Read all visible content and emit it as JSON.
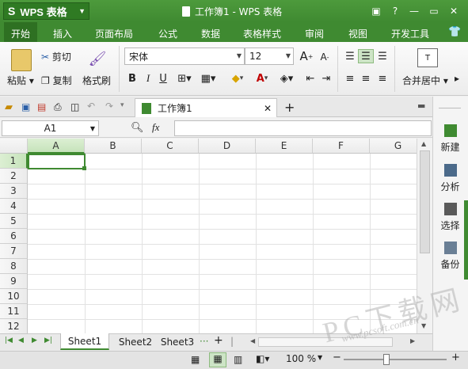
{
  "app": {
    "name": "WPS 表格",
    "logo": "S",
    "title": "工作簿1 - WPS 表格"
  },
  "menu_tabs": [
    "开始",
    "插入",
    "页面布局",
    "公式",
    "数据",
    "表格样式",
    "审阅",
    "视图",
    "开发工具"
  ],
  "ribbon": {
    "paste": "粘贴",
    "cut": "剪切",
    "copy": "复制",
    "format_painter": "格式刷",
    "font_name": "宋体",
    "font_size": "12",
    "merge_center": "合并居中"
  },
  "doc_tab": {
    "name": "工作簿1"
  },
  "formula_bar": {
    "name_box": "A1",
    "fx": "fx",
    "value": ""
  },
  "columns": [
    "A",
    "B",
    "C",
    "D",
    "E",
    "F",
    "G"
  ],
  "rows": [
    "1",
    "2",
    "3",
    "4",
    "5",
    "6",
    "7",
    "8",
    "9",
    "10",
    "11",
    "12"
  ],
  "sheets": [
    "Sheet1",
    "Sheet2",
    "Sheet3"
  ],
  "sheet_more": "···",
  "status": {
    "zoom": "100 %"
  },
  "right_panel": [
    "新建",
    "分析",
    "选择",
    "备份"
  ],
  "watermark": {
    "big": "PC下载网",
    "url": "www.pcsoft.com.cn"
  },
  "colors": {
    "accent": "#3f8a31",
    "selected": "#3f8a31"
  }
}
